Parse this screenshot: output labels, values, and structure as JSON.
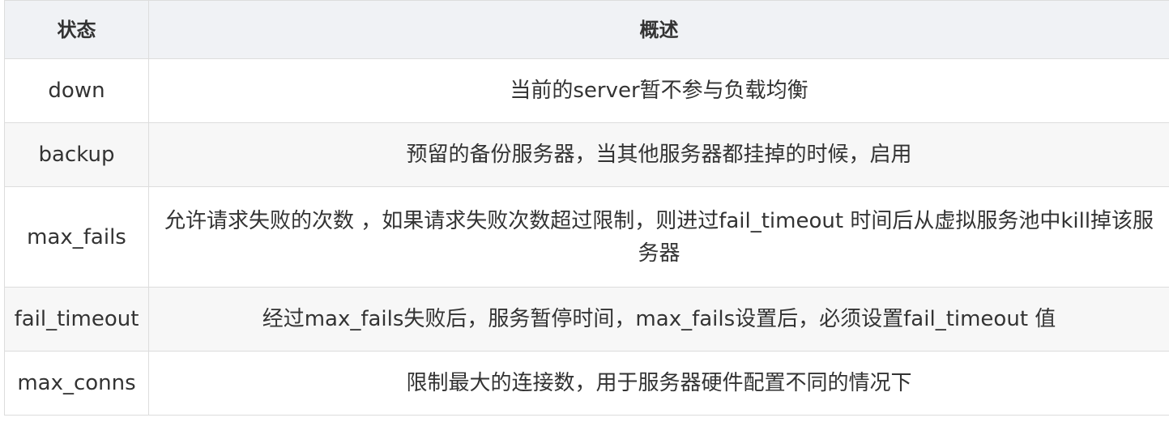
{
  "table": {
    "headers": [
      "状态",
      "概述"
    ],
    "rows": [
      {
        "state": "down",
        "desc": "当前的server暂不参与负载均衡"
      },
      {
        "state": "backup",
        "desc": "预留的备份服务器，当其他服务器都挂掉的时候，启用"
      },
      {
        "state": "max_fails",
        "desc": "允许请求失败的次数 ，如果请求失败次数超过限制，则进过fail_timeout 时间后从虚拟服务池中kill掉该服务器"
      },
      {
        "state": "fail_timeout",
        "desc": "经过max_fails失败后，服务暂停时间，max_fails设置后，必须设置fail_timeout 值"
      },
      {
        "state": "max_conns",
        "desc": "限制最大的连接数，用于服务器硬件配置不同的情况下"
      }
    ]
  }
}
